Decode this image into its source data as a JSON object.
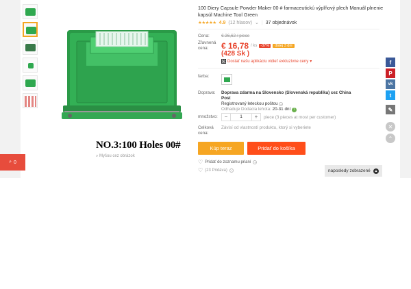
{
  "product": {
    "title": "100 Diery Capsule Powder Maker 00 # farmaceutickú výplňový plech Manuál plnenie kapsúl Machine Tool Green",
    "rating_stars": "★★★★★",
    "rating_value": "4.9",
    "rating_count": "(12 hlasov)",
    "orders": "37 objednávok",
    "image_caption": "NO.3:100 Holes  00#",
    "zoom_hint": "Myšou cez obrázok"
  },
  "price": {
    "label": "Cena:",
    "old": "€ 26,62 / piece",
    "discount_label_1": "Zľavnená",
    "discount_label_2": "cena:",
    "new": "€ 16,78",
    "unit": "/ ks",
    "off_badge": "-37%",
    "time_badge": "ďalej 3 dni",
    "sk": "(428 Sk )",
    "app_promo": "Dostať našu aplikáciu vidieť exkluzívne ceny"
  },
  "color": {
    "label": "farba:"
  },
  "shipping": {
    "label": "Doprava:",
    "text_bold": "Doprava zdarma na Slovensko (Slovenská republika) cez China Post",
    "text_2": "Registrovaný leteckou poštou",
    "est_label": "Odhaduje Dodacia lehota:",
    "est_value": "20-31",
    "est_unit": "dní"
  },
  "quantity": {
    "label": "množstvo:",
    "minus": "−",
    "value": "1",
    "plus": "+",
    "note": "piece (3 pieces at most per customer)"
  },
  "total": {
    "label_1": "Celková",
    "label_2": "cena:",
    "text": "Závisí od vlastností produktu, ktorý si vyberiete"
  },
  "buttons": {
    "buy": "Kúp teraz",
    "cart": "Pridať do košíka"
  },
  "wishlist": {
    "add": "Pridať do zoznamu prianí",
    "count": "(23 Pridáva)"
  },
  "cart_widget": {
    "count": "0"
  },
  "recent": {
    "label": "naposledy zobrazené"
  },
  "social": {
    "facebook": "f",
    "pinterest": "P",
    "vk": "vk",
    "twitter": "t"
  },
  "colors": {
    "accent": "#e8452e",
    "buy": "#f6a623",
    "cart": "#ff4e1a",
    "product_green": "#2fa84f"
  }
}
